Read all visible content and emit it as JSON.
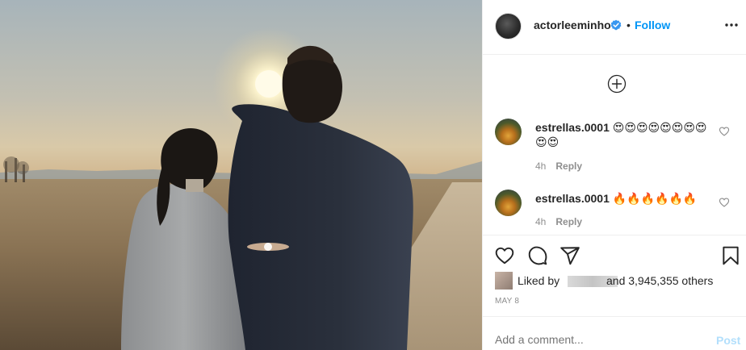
{
  "photo": {
    "alt_label": ""
  },
  "header": {
    "username": "actorleeminho",
    "separator": "•",
    "follow_label": "Follow",
    "verified_icon": "verified-badge-icon",
    "more_icon": "more-options-icon"
  },
  "load_more_icon": "plus-circle-icon",
  "comments": [
    {
      "username": "estrellas.0001",
      "text": "😍😍😍😍😍😍😍😍😍😍",
      "time": "4h",
      "reply_label": "Reply"
    },
    {
      "username": "estrellas.0001",
      "text": "🔥🔥🔥🔥🔥🔥",
      "time": "4h",
      "reply_label": "Reply"
    }
  ],
  "actions": {
    "like_icon": "heart-icon",
    "comment_icon": "comment-icon",
    "share_icon": "share-icon",
    "save_icon": "bookmark-icon"
  },
  "likes": {
    "prefix": "Liked by",
    "suffix": "and 3,945,355 others"
  },
  "date": "MAY 8",
  "add_comment": {
    "placeholder": "Add a comment...",
    "post_label": "Post"
  },
  "colors": {
    "accent": "#0095f6",
    "post_disabled": "#b2dffc",
    "text": "#262626",
    "muted": "#8e8e8e",
    "border": "#efefef"
  }
}
